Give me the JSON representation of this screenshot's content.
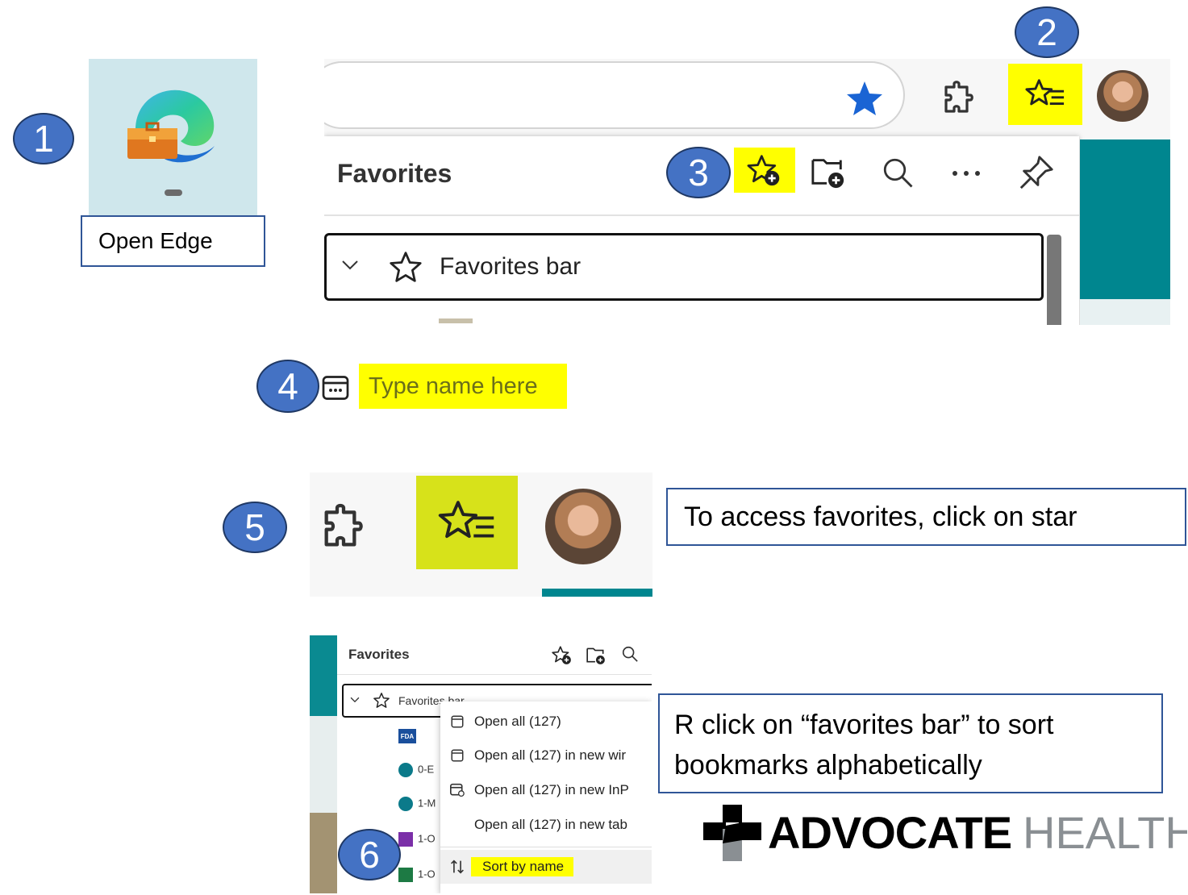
{
  "steps": [
    "1",
    "2",
    "3",
    "4",
    "5",
    "6"
  ],
  "step1": {
    "caption": "Open Edge"
  },
  "panel": {
    "title": "Favorites",
    "favorites_bar_label": "Favorites bar"
  },
  "step4": {
    "name_placeholder": "Type name here"
  },
  "step5": {
    "caption": "To access favorites, click on star"
  },
  "step6": {
    "panel_title": "Favorites",
    "favorites_bar_label": "Favorites bar",
    "tree_items": [
      "0-E",
      "1-M",
      "1-O",
      "1-O"
    ],
    "context_menu": [
      "Open all (127)",
      "Open all (127) in new wir",
      "Open all (127) in new InP",
      "Open all (127) in new tab",
      "Sort by name"
    ],
    "caption": "R click on “favorites bar” to sort bookmarks alphabetically"
  },
  "logo": {
    "bold": "ADVOCATE",
    "light": "HEALTH"
  },
  "colors": {
    "highlight": "#ffff00",
    "step_fill": "#4472c4",
    "teal": "#00868f",
    "favorite_star": "#1a64d4"
  },
  "icons": [
    "edge-icon",
    "favorite-star-icon",
    "extensions-icon",
    "favorites-list-icon",
    "avatar",
    "add-favorite-icon",
    "add-folder-icon",
    "search-icon",
    "more-icon",
    "pin-icon",
    "chevron-down-icon",
    "star-outline-icon",
    "favorite-page-icon",
    "sort-icon"
  ]
}
